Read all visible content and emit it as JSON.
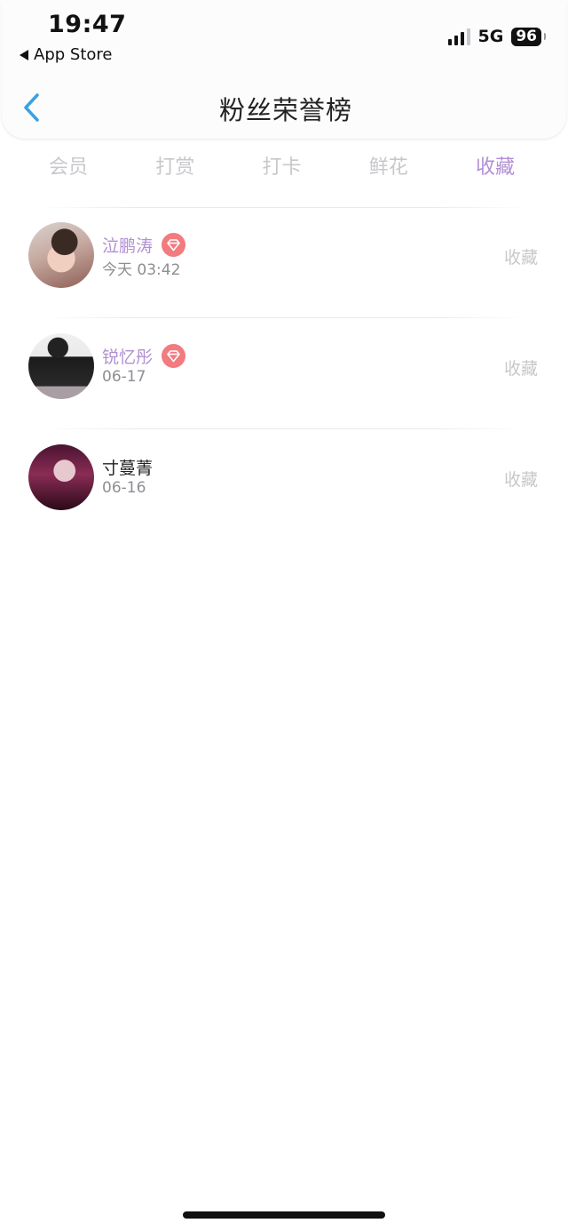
{
  "status_bar": {
    "time": "19:47",
    "back_app": "App Store",
    "network": "5G",
    "battery": "96"
  },
  "nav": {
    "title": "粉丝荣誉榜"
  },
  "tabs": [
    {
      "label": "会员",
      "active": false
    },
    {
      "label": "打赏",
      "active": false
    },
    {
      "label": "打卡",
      "active": false
    },
    {
      "label": "鲜花",
      "active": false
    },
    {
      "label": "收藏",
      "active": true
    }
  ],
  "list": [
    {
      "name": "泣鹏涛",
      "date": "今天 03:42",
      "action": "收藏",
      "vip": true,
      "name_color": "#b28fd4"
    },
    {
      "name": "锐忆彤",
      "date": "06-17",
      "action": "收藏",
      "vip": true,
      "name_color": "#b28fd4"
    },
    {
      "name": "寸蔓菁",
      "date": "06-16",
      "action": "收藏",
      "vip": false,
      "name_color": "#222222"
    }
  ],
  "colors": {
    "accent": "#b28fd4",
    "tab_inactive": "#c8c8cc",
    "vip_badge": "#f27b7f",
    "back_arrow": "#3aa0e0"
  }
}
